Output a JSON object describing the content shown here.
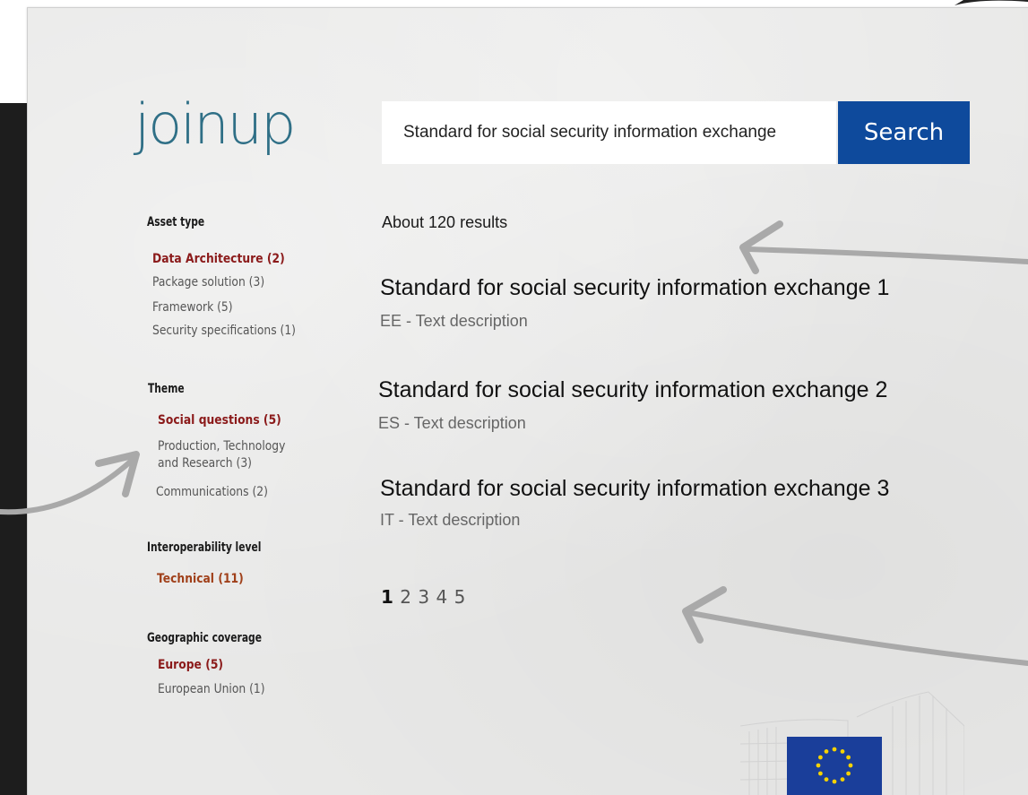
{
  "brand": {
    "logo_text": "joinup"
  },
  "search": {
    "query": "Standard for social security information exchange",
    "button_label": "Search"
  },
  "facets": {
    "asset_type": {
      "heading": "Asset type",
      "items": [
        {
          "label": "Data Architecture (2)",
          "active": true
        },
        {
          "label": "Package solution (3)",
          "active": false
        },
        {
          "label": "Framework (5)",
          "active": false
        },
        {
          "label": "Security specifications (1)",
          "active": false
        }
      ]
    },
    "theme": {
      "heading": "Theme",
      "items": [
        {
          "label": "Social questions (5)",
          "active": true
        },
        {
          "label": "Production, Technology",
          "active": false
        },
        {
          "label": "and Research (3)",
          "active": false
        },
        {
          "label": "Communications (2)",
          "active": false
        }
      ]
    },
    "interoperability": {
      "heading": "Interoperability level",
      "items": [
        {
          "label": "Technical (11)",
          "active": true
        }
      ]
    },
    "geographic": {
      "heading": "Geographic coverage",
      "items": [
        {
          "label": "Europe (5)",
          "active": true
        },
        {
          "label": "European Union (1)",
          "active": false
        }
      ]
    }
  },
  "results": {
    "count_text": "About 120 results",
    "items": [
      {
        "title": "Standard for social security information exchange 1",
        "description": "EE - Text description"
      },
      {
        "title": "Standard for social security information exchange 2",
        "description": "ES - Text description"
      },
      {
        "title": "Standard for social security information exchange 3",
        "description": "IT - Text description"
      }
    ]
  },
  "pagination": {
    "pages": [
      "1",
      "2",
      "3",
      "4",
      "5"
    ],
    "current": "1"
  },
  "colors": {
    "search_button": "#0e4a9c",
    "logo": "#2f6f86",
    "active_facet": "#8b1a1a",
    "eu_blue": "#1a3e9a",
    "eu_star": "#f5d200"
  },
  "icons": {
    "annotation_arrows": "hand-drawn-arrow",
    "eu_emblem": "eu-flag-icon"
  }
}
